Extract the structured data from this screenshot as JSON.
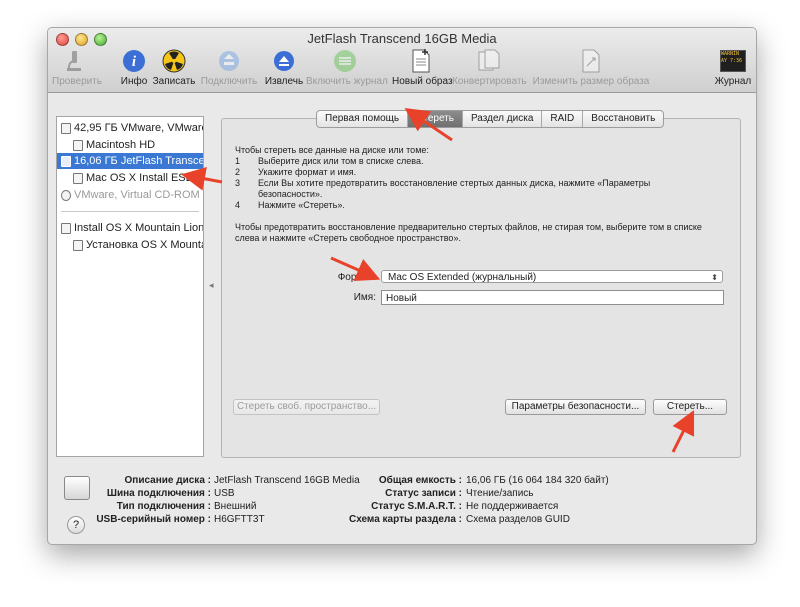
{
  "window": {
    "title": "JetFlash Transcend 16GB Media"
  },
  "toolbar": {
    "verify": "Проверить",
    "info": "Инфо",
    "burn": "Записать",
    "mount": "Подключить",
    "eject": "Извлечь",
    "enable_journal": "Включить журнал",
    "new_image": "Новый образ",
    "convert": "Конвертировать",
    "resize": "Изменить размер образа",
    "log": "Журнал",
    "log_screen_1": "WARNIN",
    "log_screen_2": "AY 7:36"
  },
  "sidebar": {
    "items": [
      {
        "label": "42,95 ГБ VMware, VMware."
      },
      {
        "label": "Macintosh HD"
      },
      {
        "label": "16,06 ГБ JetFlash Transcen."
      },
      {
        "label": "Mac OS X Install ESD"
      },
      {
        "label": "VMware, Virtual CD-ROM"
      },
      {
        "label": "Install OS X Mountain Lion..."
      },
      {
        "label": "Установка OS X Mountai"
      }
    ]
  },
  "tabs": {
    "first_aid": "Первая помощь",
    "erase": "Стереть",
    "partition": "Раздел диска",
    "raid": "RAID",
    "restore": "Восстановить"
  },
  "erase": {
    "intro": "Чтобы стереть все данные на диске или томе:",
    "steps": [
      {
        "num": "1",
        "text": "Выберите диск или том в списке слева."
      },
      {
        "num": "2",
        "text": "Укажите формат и имя."
      },
      {
        "num": "3",
        "text": "Если Вы хотите предотвратить восстановление стертых данных диска, нажмите «Параметры безопасности»."
      },
      {
        "num": "4",
        "text": "Нажмите «Стереть»."
      }
    ],
    "note": "Чтобы предотвратить восстановление предварительно стертых файлов, не стирая том, выберите том в списке слева и нажмите «Стереть свободное пространство».",
    "format_label": "Формат:",
    "format_value": "Mac OS Extended (журнальный)",
    "name_label": "Имя:",
    "name_value": "Новый",
    "erase_free_button": "Стереть своб. пространство...",
    "security_button": "Параметры безопасности...",
    "erase_button": "Стереть..."
  },
  "info": {
    "left": [
      {
        "key": "Описание диска :",
        "value": "JetFlash Transcend 16GB Media"
      },
      {
        "key": "Шина подключения :",
        "value": "USB"
      },
      {
        "key": "Тип подключения :",
        "value": "Внешний"
      },
      {
        "key": "USB-серийный номер :",
        "value": "H6GFTT3T"
      }
    ],
    "right": [
      {
        "key": "Общая емкость :",
        "value": "16,06 ГБ (16 064 184 320 байт)"
      },
      {
        "key": "Статус записи :",
        "value": "Чтение/запись"
      },
      {
        "key": "Статус S.M.A.R.T. :",
        "value": "Не поддерживается"
      },
      {
        "key": "Схема карты раздела :",
        "value": "Схема разделов GUID"
      }
    ],
    "help": "?"
  },
  "colors": {
    "selection": "#3a78d4",
    "annotation_arrow": "#e8432a"
  }
}
